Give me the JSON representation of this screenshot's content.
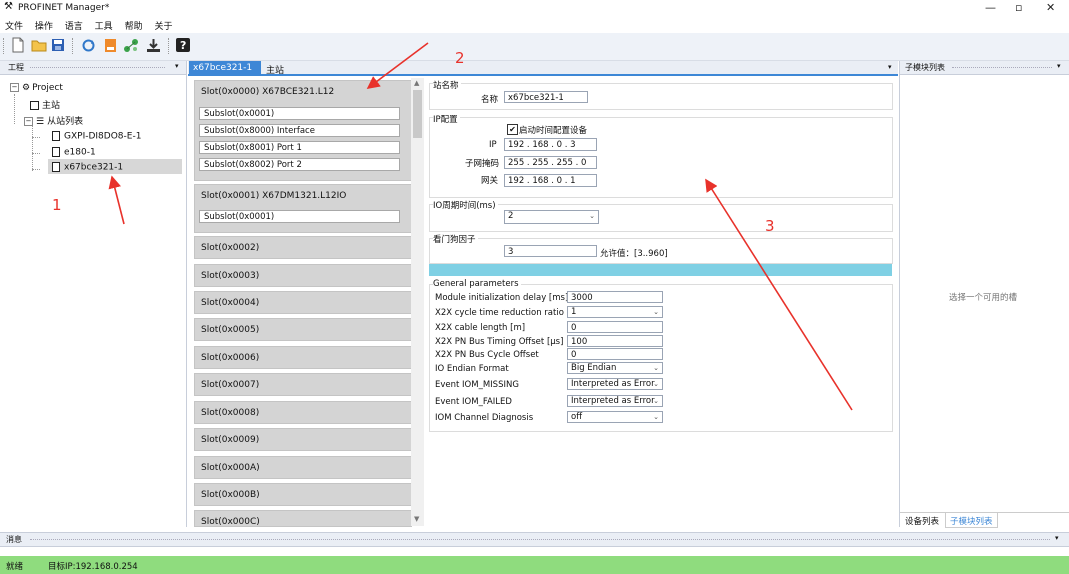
{
  "window": {
    "title": "PROFINET Manager*",
    "controls": [
      "—",
      "▫",
      "✕"
    ]
  },
  "menu": [
    "文件",
    "操作",
    "语言",
    "工具",
    "帮助",
    "关于"
  ],
  "toolbar_icons": [
    "new-file-icon",
    "open-folder-icon",
    "save-icon",
    "refresh-icon",
    "export-icon",
    "network-icon",
    "download-icon",
    "help-icon"
  ],
  "project_panel": {
    "title": "工程",
    "root": "Project",
    "master": "主站",
    "slave_list": "从站列表",
    "devices": [
      "GXPI-DI8DO8-E-1",
      "e180-1",
      "x67bce321-1"
    ]
  },
  "tabs": [
    "x67bce321-1",
    "主站"
  ],
  "slots": [
    {
      "label": "Slot(0x0000)    X67BCE321.L12",
      "subslots": [
        "Subslot(0x0001)",
        "Subslot(0x8000)    Interface",
        "Subslot(0x8001)    Port 1",
        "Subslot(0x8002)    Port 2"
      ]
    },
    {
      "label": "Slot(0x0001)    X67DM1321.L12IO",
      "subslots": [
        "Subslot(0x0001)"
      ]
    },
    {
      "label": "Slot(0x0002)"
    },
    {
      "label": "Slot(0x0003)"
    },
    {
      "label": "Slot(0x0004)"
    },
    {
      "label": "Slot(0x0005)"
    },
    {
      "label": "Slot(0x0006)"
    },
    {
      "label": "Slot(0x0007)"
    },
    {
      "label": "Slot(0x0008)"
    },
    {
      "label": "Slot(0x0009)"
    },
    {
      "label": "Slot(0x000A)"
    },
    {
      "label": "Slot(0x000B)"
    },
    {
      "label": "Slot(0x000C)"
    }
  ],
  "station": {
    "group_title": "站名称",
    "name_label": "名称",
    "name_value": "x67bce321-1"
  },
  "ip": {
    "group_title": "IP配置",
    "checkbox_label": "启动时间配置设备",
    "checkbox_mark": "✔",
    "ip_label": "IP",
    "ip_value": "192 . 168 .  0  .  3",
    "mask_label": "子网掩码",
    "mask_value": "255 . 255 . 255 .  0",
    "gateway_label": "网关",
    "gateway_value": "192 . 168 .  0  .  1"
  },
  "io_cycle": {
    "group_title": "IO周期时间(ms)",
    "value": "2"
  },
  "watchdog": {
    "group_title": "看门狗因子",
    "value": "3",
    "hint": "允许值：[3..960]"
  },
  "general": {
    "title": "General parameters",
    "rows": [
      {
        "label": "Module initialization delay [ms]",
        "value": "3000"
      },
      {
        "label": "X2X cycle time reduction ratio",
        "value": "1"
      },
      {
        "label": "X2X cable length [m]",
        "value": "0"
      },
      {
        "label": "X2X PN Bus Timing Offset [µs]",
        "value": "100"
      },
      {
        "label": "X2X PN Bus Cycle Offset",
        "value": "0"
      },
      {
        "label": "IO Endian Format",
        "value": "Big Endian"
      },
      {
        "label": "Event IOM_MISSING",
        "value": "Interpreted as Error"
      },
      {
        "label": "Event IOM_FAILED",
        "value": "Interpreted as Error"
      },
      {
        "label": "IOM Channel Diagnosis",
        "value": "off"
      }
    ]
  },
  "submodule_panel": {
    "title": "子模块列表",
    "empty_hint": "选择一个可用的槽",
    "bottom_tabs": [
      "设备列表",
      "子模块列表"
    ]
  },
  "message_panel": {
    "title": "消息"
  },
  "statusbar": {
    "state": "就绪",
    "target": "目标IP:192.168.0.254"
  },
  "annotations": [
    "1",
    "2",
    "3"
  ],
  "colors": {
    "status_bar": "#8fdc7e",
    "tab_active": "#3d87d6",
    "progress": "#7fd0e4",
    "annotation_red": "#e8322b"
  }
}
